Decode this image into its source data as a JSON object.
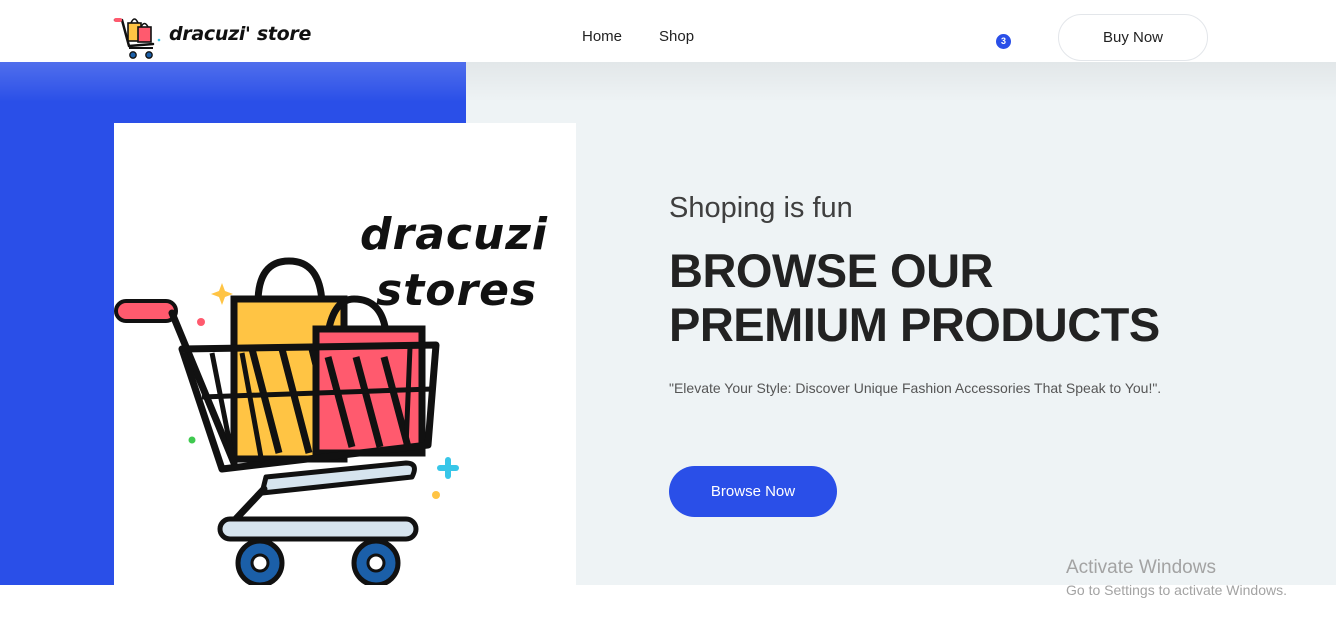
{
  "header": {
    "brand": "dracuzi' store",
    "nav": [
      {
        "label": "Home"
      },
      {
        "label": "Shop"
      }
    ],
    "cart_count": "3",
    "buy_label": "Buy Now"
  },
  "hero": {
    "image_brand_line1": "dracuzi",
    "image_brand_line2": "stores",
    "subtitle": "Shoping is fun",
    "headline_line1": "BROWSE OUR",
    "headline_line2": "PREMIUM PRODUCTS",
    "tagline": "\"Elevate Your Style: Discover Unique Fashion Accessories That Speak to You!\".",
    "cta_label": "Browse Now"
  },
  "watermark": {
    "title": "Activate Windows",
    "subtitle": "Go to Settings to activate Windows."
  },
  "colors": {
    "accent": "#2a4fe8",
    "hero_background": "#eef3f5",
    "bag_yellow": "#ffc444",
    "bag_pink": "#ff5a6e"
  }
}
